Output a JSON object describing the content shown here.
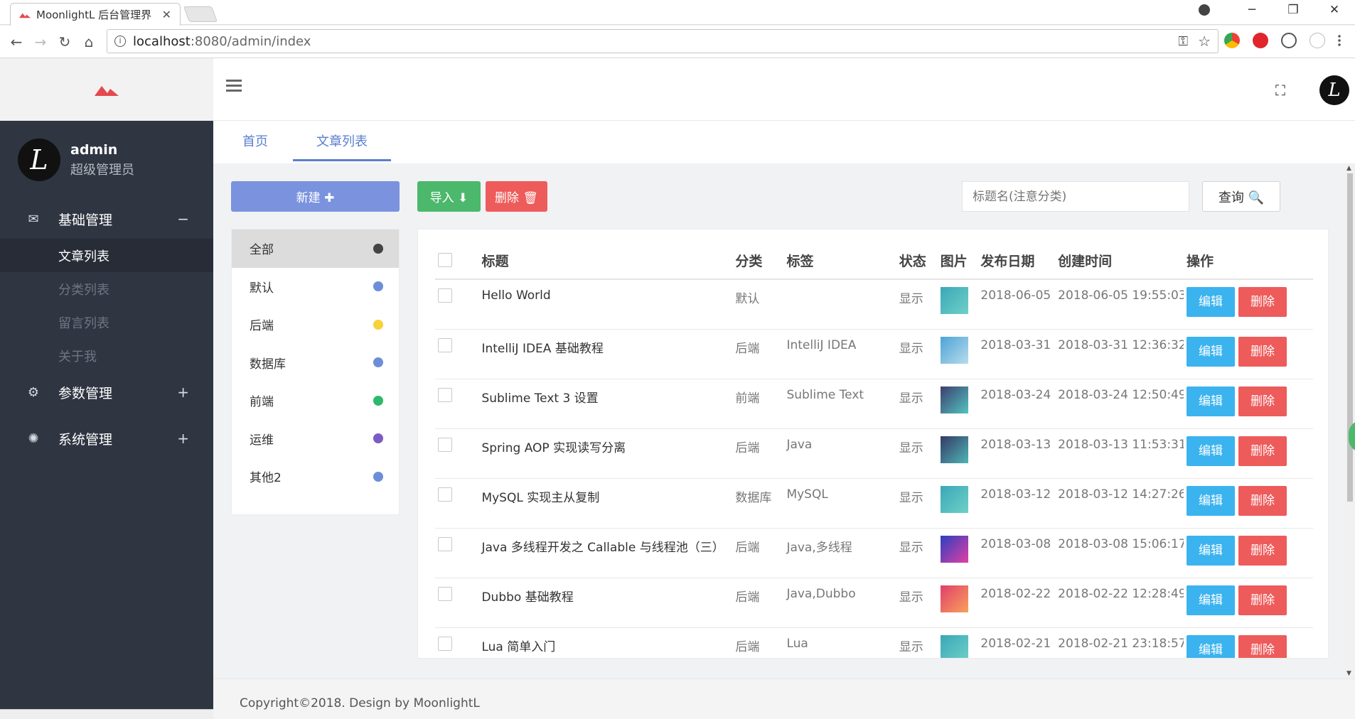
{
  "browser": {
    "tab_title": "MoonlightL 后台管理界",
    "close_glyph": "✕",
    "url_host": "localhost",
    "url_path": ":8080/admin/index"
  },
  "sidebar": {
    "user": {
      "avatar_letter": "L",
      "name": "admin",
      "role": "超级管理员"
    },
    "groups": [
      {
        "label": "基础管理",
        "toggle": "−",
        "icon": "envelope-icon"
      },
      {
        "label": "参数管理",
        "toggle": "+",
        "icon": "gear-icon"
      },
      {
        "label": "系统管理",
        "toggle": "+",
        "icon": "cog-icon"
      }
    ],
    "submenu": [
      "文章列表",
      "分类列表",
      "留言列表",
      "关于我"
    ]
  },
  "page_tabs": [
    "首页",
    "文章列表"
  ],
  "actions": {
    "new_label": "新建 ✚",
    "import_label": "导入 ⬇",
    "delete_label": "删除 🗑",
    "search_placeholder": "标题名(注意分类)",
    "query_label": "查询 🔍"
  },
  "categories": [
    {
      "label": "全部",
      "color": "#444444"
    },
    {
      "label": "默认",
      "color": "#6c8ed8"
    },
    {
      "label": "后端",
      "color": "#f7d23b"
    },
    {
      "label": "数据库",
      "color": "#6c8ed8"
    },
    {
      "label": "前端",
      "color": "#2fb86c"
    },
    {
      "label": "运维",
      "color": "#7d5bc4"
    },
    {
      "label": "其他2",
      "color": "#6c8ed8"
    }
  ],
  "table": {
    "headers": [
      "标题",
      "分类",
      "标签",
      "状态",
      "图片",
      "发布日期",
      "创建时间",
      "操作"
    ],
    "edit_label": "编辑",
    "delete_label": "删除",
    "rows": [
      {
        "title": "Hello World",
        "category": "默认",
        "tags": "",
        "status": "显示",
        "publish": "2018-06-05",
        "created": "2018-06-05 19:55:03",
        "thumb": [
          "#3aa7b8",
          "#6fd0c7"
        ]
      },
      {
        "title": "IntelliJ IDEA 基础教程",
        "category": "后端",
        "tags": "IntelliJ IDEA",
        "status": "显示",
        "publish": "2018-03-31",
        "created": "2018-03-31 12:36:32",
        "thumb": [
          "#4ca3d8",
          "#b8dceb"
        ]
      },
      {
        "title": "Sublime Text 3 设置",
        "category": "前端",
        "tags": "Sublime Text",
        "status": "显示",
        "publish": "2018-03-24",
        "created": "2018-03-24 12:50:49",
        "thumb": [
          "#3a3f6e",
          "#55c4c0"
        ]
      },
      {
        "title": "Spring AOP 实现读写分离",
        "category": "后端",
        "tags": "Java",
        "status": "显示",
        "publish": "2018-03-13",
        "created": "2018-03-13 11:53:31",
        "thumb": [
          "#333a66",
          "#50b5b5"
        ]
      },
      {
        "title": "MySQL 实现主从复制",
        "category": "数据库",
        "tags": "MySQL",
        "status": "显示",
        "publish": "2018-03-12",
        "created": "2018-03-12 14:27:26",
        "thumb": [
          "#3aa7b8",
          "#6fd0c7"
        ]
      },
      {
        "title": "Java 多线程开发之 Callable 与线程池（三）",
        "category": "后端",
        "tags": "Java,多线程",
        "status": "显示",
        "publish": "2018-03-08",
        "created": "2018-03-08 15:06:17",
        "thumb": [
          "#2a3fc0",
          "#e33fa5"
        ]
      },
      {
        "title": "Dubbo 基础教程",
        "category": "后端",
        "tags": "Java,Dubbo",
        "status": "显示",
        "publish": "2018-02-22",
        "created": "2018-02-22 12:28:49",
        "thumb": [
          "#e23d6a",
          "#f7a35b"
        ]
      },
      {
        "title": "Lua 简单入门",
        "category": "后端",
        "tags": "Lua",
        "status": "显示",
        "publish": "2018-02-21",
        "created": "2018-02-21 23:18:57",
        "thumb": [
          "#3aa7b8",
          "#6fd0c7"
        ]
      }
    ]
  },
  "footer": {
    "copyright": "Copyright©2018. Design by MoonlightL"
  },
  "colors": {
    "sidebar_bg": "#2f3541",
    "accent": "#5b7fcf",
    "edit": "#3bb3ef",
    "danger": "#ee5b5b",
    "success": "#4cb86c"
  }
}
